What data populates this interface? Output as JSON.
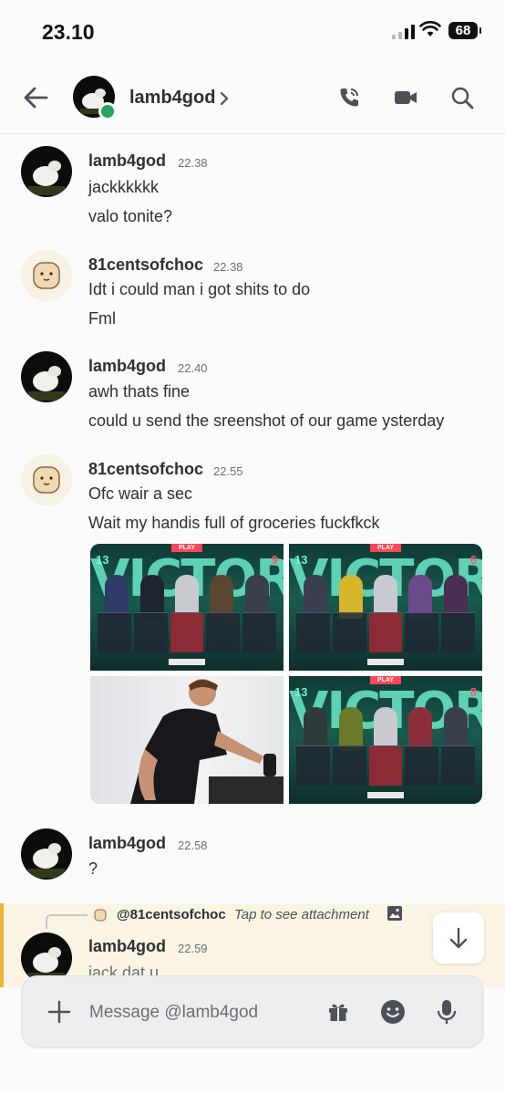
{
  "status_bar": {
    "time": "23.10",
    "battery": "68"
  },
  "header": {
    "name": "lamb4god"
  },
  "messages": [
    {
      "author": "lamb4god",
      "time": "22.38",
      "lines": [
        "jackkkkkk",
        "valo tonite?"
      ]
    },
    {
      "author": "81centsofchoc",
      "time": "22.38",
      "lines": [
        "Idt i could man i got shits to do",
        "Fml"
      ]
    },
    {
      "author": "lamb4god",
      "time": "22.40",
      "lines": [
        "awh thats fine",
        "could u send the sreenshot of our game ysterday"
      ]
    },
    {
      "author": "81centsofchoc",
      "time": "22.55",
      "lines": [
        "Ofc wair a sec",
        "Wait my handis full of groceries fuckfkck"
      ]
    },
    {
      "author": "lamb4god",
      "time": "22.58",
      "lines": [
        "?"
      ]
    },
    {
      "author": "lamb4god",
      "time": "22.59",
      "lines": [
        "jack dat u"
      ]
    }
  ],
  "attachments": {
    "shot1": {
      "banner": "VICTORY",
      "score_left": "13",
      "score_right": "9",
      "tag": "PLAY"
    },
    "shot2": {
      "banner": "VICTORY",
      "score_left": "13",
      "score_right": "6",
      "tag": "PLAY"
    },
    "shot4": {
      "banner": "VICTORY",
      "score_left": "13",
      "score_right": "8",
      "tag": "PLAY"
    }
  },
  "reply": {
    "mention": "@81centsofchoc",
    "hint": "Tap to see attachment"
  },
  "composer": {
    "placeholder": "Message @lamb4god"
  },
  "colors": {
    "online": "#23a55a",
    "reply_accent": "#f0b232",
    "victory": "#66e0c2",
    "enemy_score": "#ff5a63"
  }
}
